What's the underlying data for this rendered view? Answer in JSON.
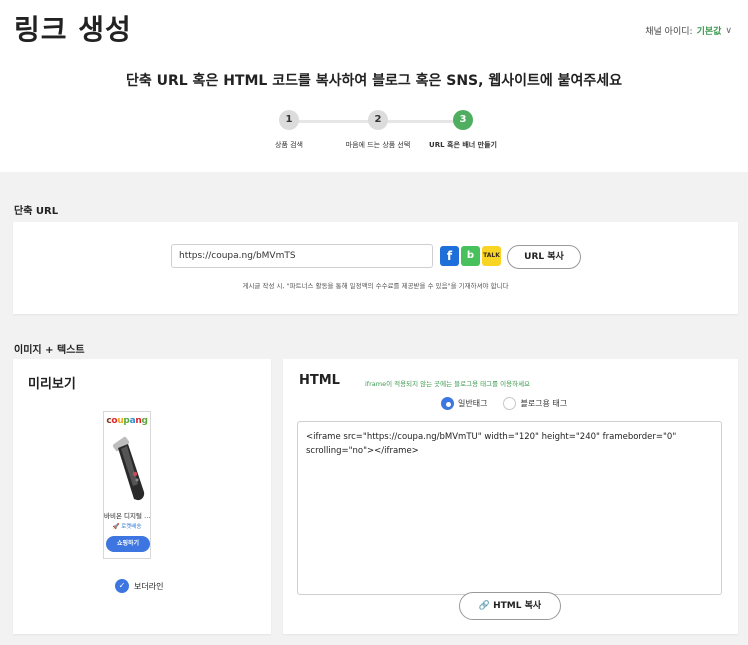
{
  "header": {
    "title": "링크 생성",
    "channel_label": "채널 아이디:",
    "channel_value": "기본값",
    "headline": "단축 URL 혹은 HTML 코드를 복사하여 블로그 혹은 SNS, 웹사이트에 붙여주세요"
  },
  "steps": [
    {
      "num": "1",
      "label": "상품 검색",
      "active": false
    },
    {
      "num": "2",
      "label": "마음에 드는 상품 선택",
      "active": false
    },
    {
      "num": "3",
      "label": "URL 혹은 배너 만들기",
      "active": true
    }
  ],
  "short_url": {
    "section_label": "단축 URL",
    "value": "https://coupa.ng/bMVmTS",
    "share_icons": {
      "facebook": "f",
      "blog": "b",
      "kakaotalk": "TALK"
    },
    "copy_label": "URL 복사",
    "note": "게시글 작성 시, \"파트너스 활동을 통해 일정액의 수수료를 제공받을 수 있음\"을 기재하셔야 합니다"
  },
  "image_text": {
    "section_label": "이미지 + 텍스트",
    "preview": {
      "title": "미리보기",
      "ad_logo": [
        "c",
        "o",
        "u",
        "p",
        "a",
        "n",
        "g"
      ],
      "product_name": "바비온 디지털 …",
      "shipping": "로켓배송",
      "shop_button": "쇼핑하기",
      "border_label": "보더라인",
      "border_checked": true
    },
    "html": {
      "title": "HTML",
      "hint": "iframe이 적용되지 않는 곳에는 블로그용 태그를 이용하세요",
      "radio_general": "일반태그",
      "radio_blog": "블로그용 태그",
      "selected": "일반태그",
      "code": "<iframe src=\"https://coupa.ng/bMVmTU\" width=\"120\" height=\"240\" frameborder=\"0\" scrolling=\"no\"></iframe>",
      "copy_label": "HTML 복사"
    }
  },
  "colors": {
    "accent_green": "#4fae5f",
    "accent_blue": "#3d76e0"
  }
}
